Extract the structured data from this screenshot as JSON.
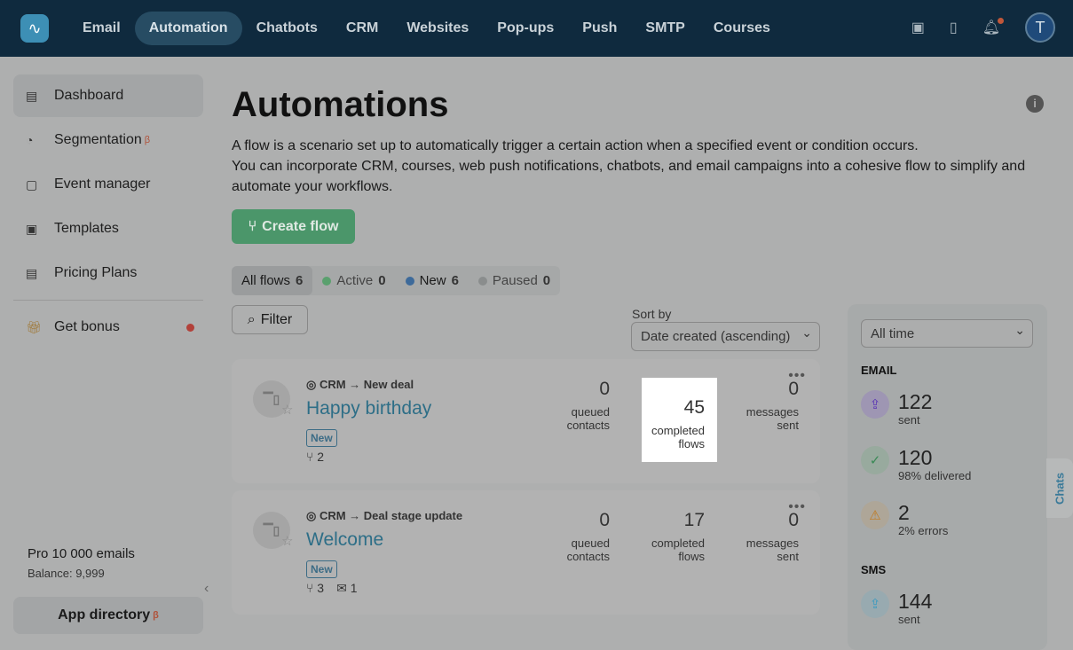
{
  "nav": {
    "items": [
      "Email",
      "Automation",
      "Chatbots",
      "CRM",
      "Websites",
      "Pop-ups",
      "Push",
      "SMTP",
      "Courses"
    ],
    "active": "Automation",
    "avatar": "T"
  },
  "sidebar": {
    "items": [
      {
        "label": "Dashboard"
      },
      {
        "label": "Segmentation",
        "sup": "β"
      },
      {
        "label": "Event manager"
      },
      {
        "label": "Templates"
      },
      {
        "label": "Pricing Plans"
      }
    ],
    "bonus": "Get bonus",
    "plan": "Pro 10 000 emails",
    "balance": "Balance: 9,999",
    "app_directory": "App directory",
    "app_sup": "β"
  },
  "page": {
    "title": "Automations",
    "desc1": "A flow is a scenario set up to automatically trigger a certain action when a specified event or condition occurs.",
    "desc2": "You can incorporate CRM, courses, web push notifications, chatbots, and email campaigns into a cohesive flow to simplify and automate your workflows.",
    "create": "Create flow"
  },
  "tabs": [
    {
      "label": "All flows",
      "count": "6"
    },
    {
      "label": "Active",
      "count": "0",
      "color": "#5aa06e"
    },
    {
      "label": "New",
      "count": "6",
      "color": "#3d6a9a"
    },
    {
      "label": "Paused",
      "count": "0",
      "color": "#8a8d8d"
    }
  ],
  "filter": "Filter",
  "sort": {
    "label": "Sort by",
    "value": "Date created (ascending)"
  },
  "flows": [
    {
      "trigger": "CRM → New deal",
      "name": "Happy birthday",
      "badge": "New",
      "branches": "2",
      "queued": "0",
      "queued_l1": "queued",
      "queued_l2": "contacts",
      "completed": "45",
      "completed_l1": "completed",
      "completed_l2": "flows",
      "messages": "0",
      "messages_l1": "messages",
      "messages_l2": "sent"
    },
    {
      "trigger": "CRM → Deal stage update",
      "name": "Welcome",
      "badge": "New",
      "branches": "3",
      "emails": "1",
      "queued": "0",
      "queued_l1": "queued",
      "queued_l2": "contacts",
      "completed": "17",
      "completed_l1": "completed",
      "completed_l2": "flows",
      "messages": "0",
      "messages_l1": "messages",
      "messages_l2": "sent"
    }
  ],
  "stats": {
    "period": "All time",
    "email_h": "EMAIL",
    "sent": "122",
    "sent_l": "sent",
    "delivered": "120",
    "delivered_l": "98% delivered",
    "errors": "2",
    "errors_l": "2% errors",
    "sms_h": "SMS",
    "sms_sent": "144",
    "sms_sent_l": "sent"
  },
  "chats": "Chats"
}
